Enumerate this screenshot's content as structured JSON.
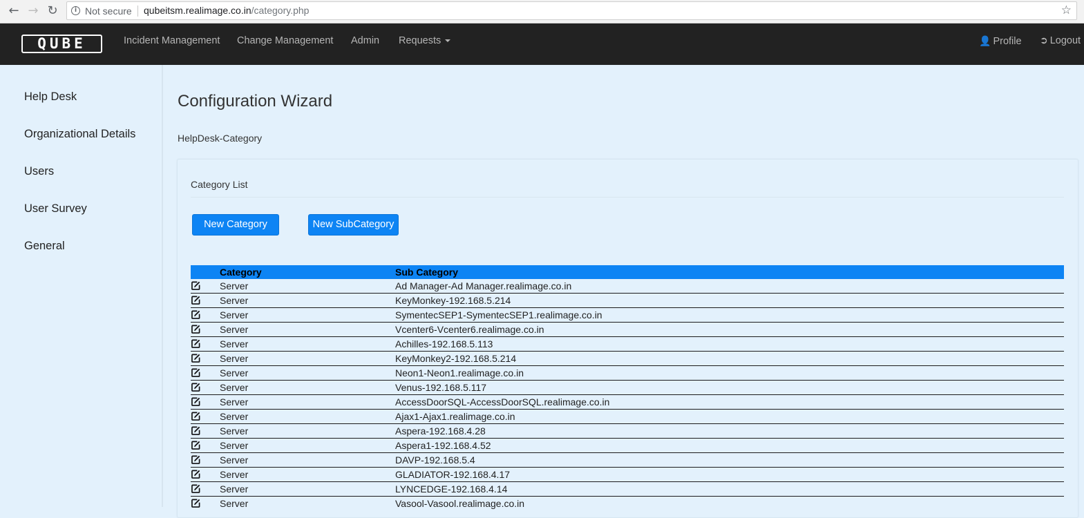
{
  "browser": {
    "security_label": "Not secure",
    "url_host": "qubeitsm.realimage.co.in",
    "url_path": "/category.php"
  },
  "navbar": {
    "logo_text": "QUBE",
    "links": [
      "Incident Management",
      "Change Management",
      "Admin",
      "Requests"
    ],
    "profile_label": "Profile",
    "logout_label": "Logout"
  },
  "sidebar": {
    "items": [
      "Help Desk",
      "Organizational Details",
      "Users",
      "User Survey",
      "General"
    ]
  },
  "main": {
    "title": "Configuration Wizard",
    "breadcrumb": "HelpDesk-Category",
    "panel_heading": "Category List",
    "new_category_label": "New Category",
    "new_subcategory_label": "New SubCategory",
    "table": {
      "headers": [
        "Category",
        "Sub Category"
      ],
      "rows": [
        {
          "category": "Server",
          "sub": "Ad Manager-Ad Manager.realimage.co.in"
        },
        {
          "category": "Server",
          "sub": "KeyMonkey-192.168.5.214"
        },
        {
          "category": "Server",
          "sub": "SymentecSEP1-SymentecSEP1.realimage.co.in"
        },
        {
          "category": "Server",
          "sub": "Vcenter6-Vcenter6.realimage.co.in"
        },
        {
          "category": "Server",
          "sub": "Achilles-192.168.5.113"
        },
        {
          "category": "Server",
          "sub": "KeyMonkey2-192.168.5.214"
        },
        {
          "category": "Server",
          "sub": "Neon1-Neon1.realimage.co.in"
        },
        {
          "category": "Server",
          "sub": "Venus-192.168.5.117"
        },
        {
          "category": "Server",
          "sub": "AccessDoorSQL-AccessDoorSQL.realimage.co.in"
        },
        {
          "category": "Server",
          "sub": "Ajax1-Ajax1.realimage.co.in"
        },
        {
          "category": "Server",
          "sub": "Aspera-192.168.4.28"
        },
        {
          "category": "Server",
          "sub": "Aspera1-192.168.4.52"
        },
        {
          "category": "Server",
          "sub": "DAVP-192.168.5.4"
        },
        {
          "category": "Server",
          "sub": "GLADIATOR-192.168.4.17"
        },
        {
          "category": "Server",
          "sub": "LYNCEDGE-192.168.4.14"
        },
        {
          "category": "Server",
          "sub": "Vasool-Vasool.realimage.co.in"
        }
      ]
    }
  },
  "colors": {
    "navbar_bg": "#222222",
    "page_bg": "#e3f1fc",
    "accent": "#0d84f4"
  },
  "icons": [
    "back-arrow-icon",
    "forward-arrow-icon",
    "reload-icon",
    "info-icon",
    "star-icon",
    "user-icon",
    "logout-icon",
    "edit-icon",
    "caret-down-icon"
  ]
}
